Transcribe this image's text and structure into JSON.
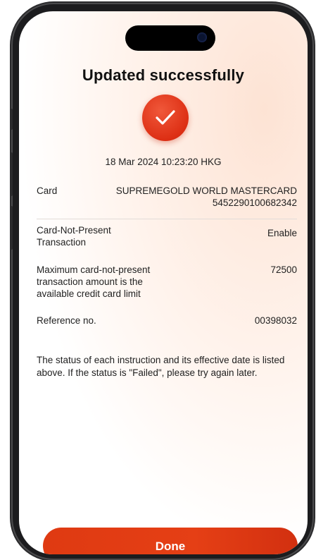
{
  "header": {
    "title": "Updated successfully"
  },
  "status": {
    "icon": "check-icon",
    "accent_color": "#e0351a"
  },
  "timestamp": "18 Mar 2024 10:23:20 HKG",
  "details": {
    "card": {
      "label": "Card",
      "name": "SUPREMEGOLD WORLD MASTERCARD",
      "number": "5452290100682342"
    },
    "cnp": {
      "label_line1": "Card-Not-Present",
      "label_line2": "Transaction",
      "value": "Enable"
    },
    "max_amount": {
      "label_line1": "Maximum card-not-present",
      "label_line2": "transaction amount is the",
      "label_line3": "available credit card limit",
      "value": "72500"
    },
    "reference": {
      "label": "Reference no.",
      "value": "00398032"
    }
  },
  "note": "The status of each instruction and its effective date is listed above. If the status is \"Failed\", please try again later.",
  "footer": {
    "done_label": "Done",
    "button_color": "#e03c14"
  }
}
